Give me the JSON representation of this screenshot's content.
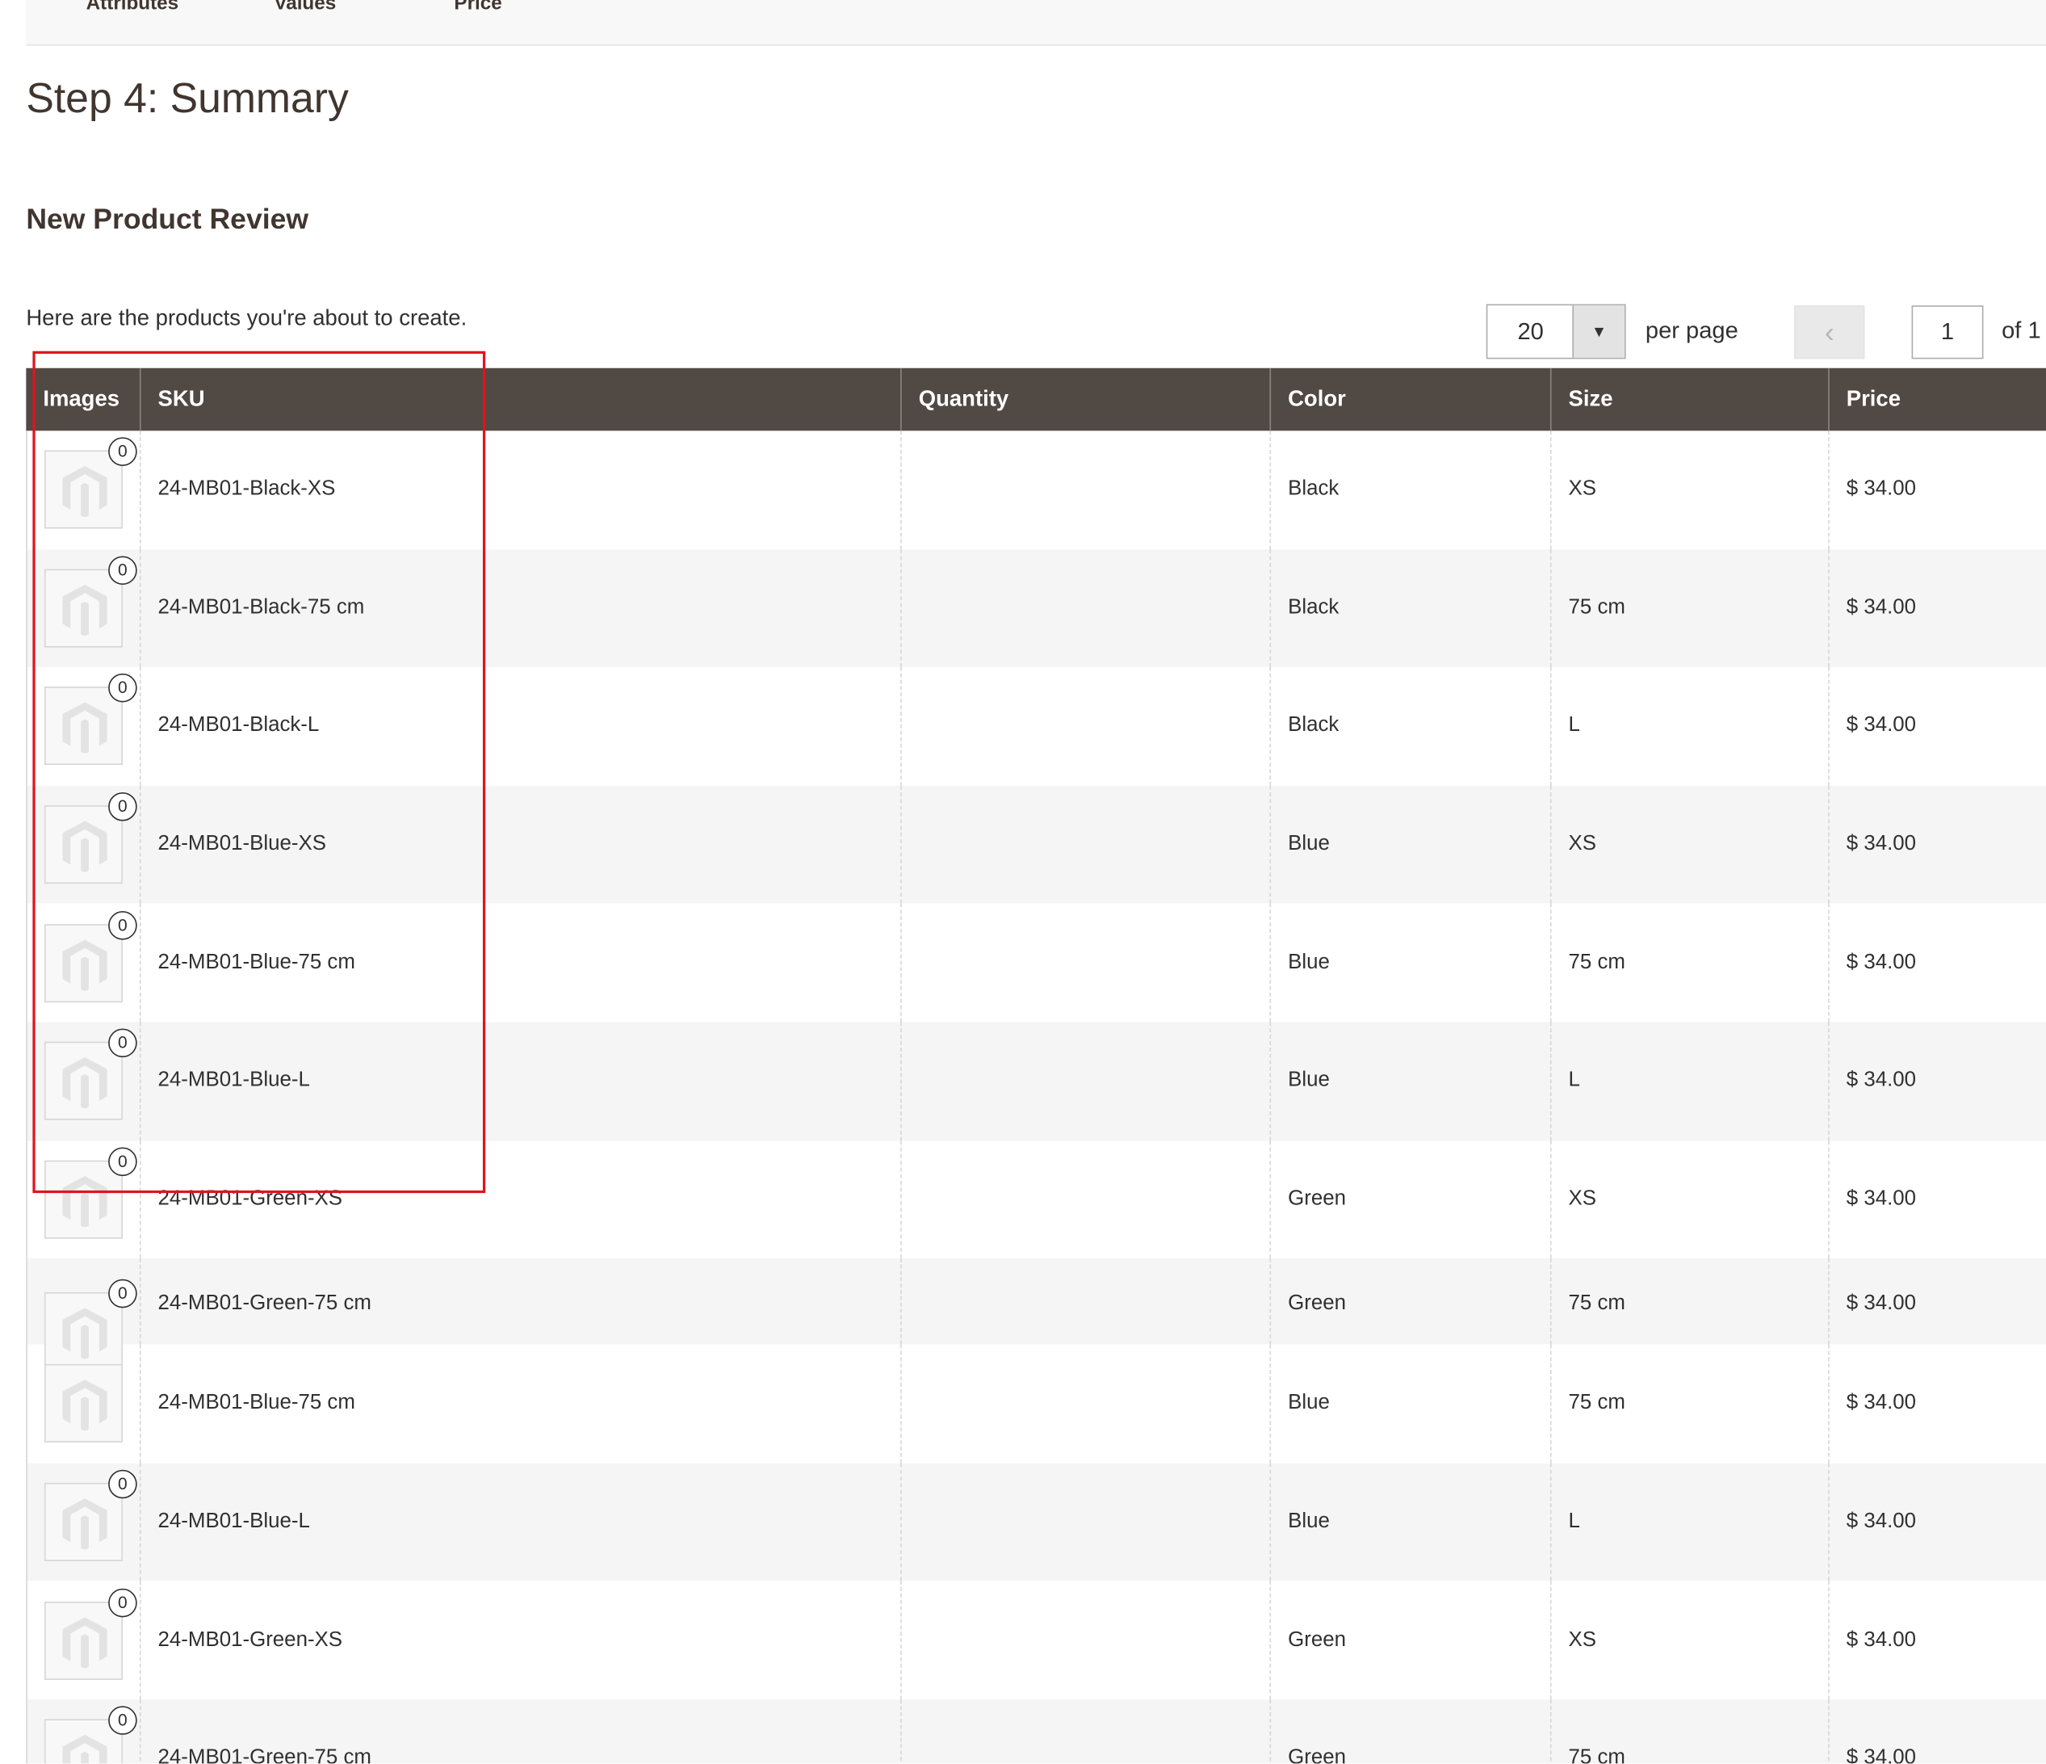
{
  "steps": [
    "Attributes",
    "Values",
    "Price"
  ],
  "page_title": "Step 4: Summary",
  "section_title": "New Product Review",
  "intro": "Here are the products you're about to create.",
  "pager": {
    "per_page_value": "20",
    "per_page_label": "per page",
    "current_page": "1",
    "total_label": "of 1"
  },
  "columns": [
    "Images",
    "SKU",
    "Quantity",
    "Color",
    "Size",
    "Price"
  ],
  "rows": [
    {
      "images": "0",
      "sku": "24-MB01-Black-XS",
      "quantity": "",
      "color": "Black",
      "size": "XS",
      "price": "$ 34.00"
    },
    {
      "images": "0",
      "sku": "24-MB01-Black-75 cm",
      "quantity": "",
      "color": "Black",
      "size": "75 cm",
      "price": "$ 34.00"
    },
    {
      "images": "0",
      "sku": "24-MB01-Black-L",
      "quantity": "",
      "color": "Black",
      "size": "L",
      "price": "$ 34.00"
    },
    {
      "images": "0",
      "sku": "24-MB01-Blue-XS",
      "quantity": "",
      "color": "Blue",
      "size": "XS",
      "price": "$ 34.00"
    },
    {
      "images": "0",
      "sku": "24-MB01-Blue-75 cm",
      "quantity": "",
      "color": "Blue",
      "size": "75 cm",
      "price": "$ 34.00"
    },
    {
      "images": "0",
      "sku": "24-MB01-Blue-L",
      "quantity": "",
      "color": "Blue",
      "size": "L",
      "price": "$ 34.00"
    },
    {
      "images": "0",
      "sku": "24-MB01-Green-XS",
      "quantity": "",
      "color": "Green",
      "size": "XS",
      "price": "$ 34.00"
    },
    {
      "images": "0",
      "sku": "24-MB01-Green-75 cm",
      "quantity": "",
      "color": "Green",
      "size": "75 cm",
      "price": "$ 34.00"
    },
    {
      "images": "",
      "sku": "24-MB01-Blue-75 cm",
      "quantity": "",
      "color": "Blue",
      "size": "75 cm",
      "price": "$ 34.00"
    },
    {
      "images": "0",
      "sku": "24-MB01-Blue-L",
      "quantity": "",
      "color": "Blue",
      "size": "L",
      "price": "$ 34.00"
    },
    {
      "images": "0",
      "sku": "24-MB01-Green-XS",
      "quantity": "",
      "color": "Green",
      "size": "XS",
      "price": "$ 34.00"
    },
    {
      "images": "0",
      "sku": "24-MB01-Green-75 cm",
      "quantity": "",
      "color": "Green",
      "size": "75 cm",
      "price": "$ 34.00"
    }
  ],
  "colors": {
    "header_bg": "#514943",
    "highlight": "#e0141e",
    "alt_row": "#f5f5f5"
  },
  "icons": {
    "placeholder": "magento-logo-icon",
    "dropdown": "caret-down-icon",
    "prev": "chevron-left-icon"
  }
}
